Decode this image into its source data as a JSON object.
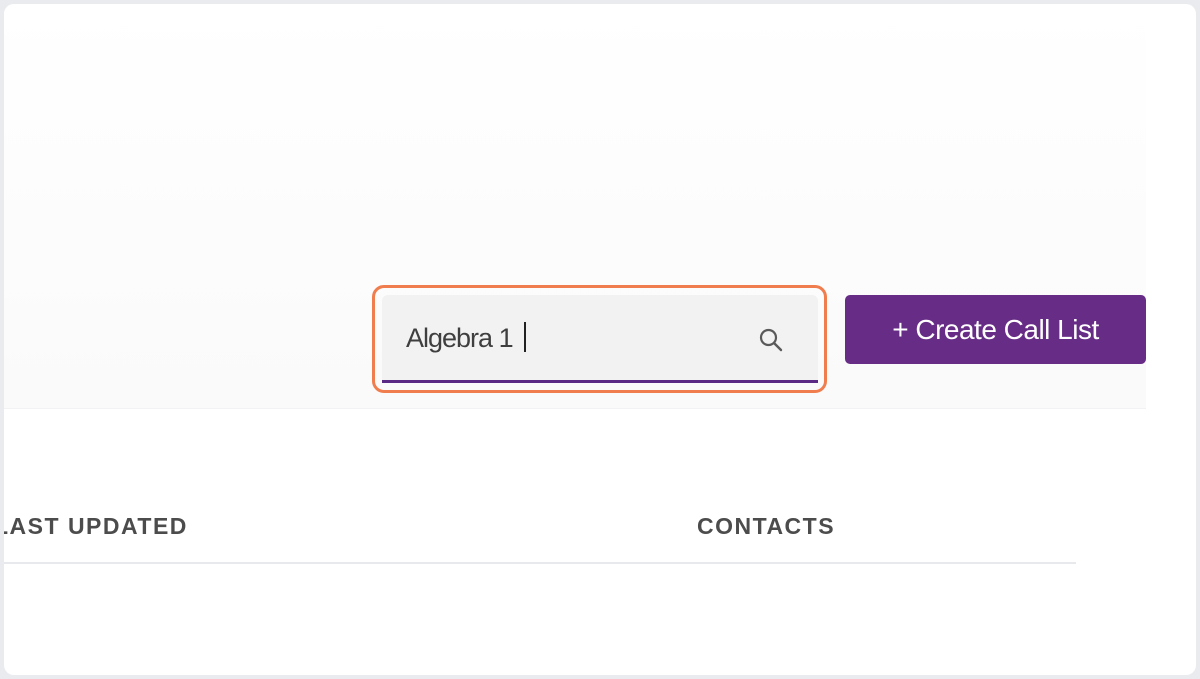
{
  "search": {
    "value": "Algebra 1",
    "icon": "search-icon"
  },
  "toolbar": {
    "create_label": "+ Create Call List"
  },
  "table": {
    "columns": [
      "LAST UPDATED",
      "CONTACTS"
    ]
  },
  "colors": {
    "accent": "#672d86",
    "highlight": "#f07d4e",
    "input_underline": "#5b2a84"
  }
}
